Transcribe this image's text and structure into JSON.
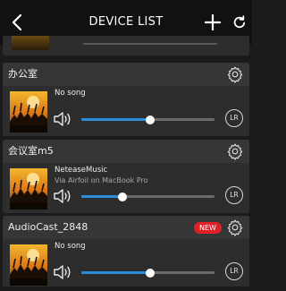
{
  "header": {
    "title": "DEVICE LIST",
    "back_icon": "chevron-left-icon",
    "add_icon": "plus-icon",
    "refresh_icon": "refresh-icon"
  },
  "colors": {
    "accent": "#2c8cd8",
    "badge": "#e01f26",
    "card": "#2d2d2d",
    "background": "#1b1b1b"
  },
  "devices": [
    {
      "name": "办公室",
      "song": "No song",
      "subtitle": "",
      "volume_fraction": 0.52,
      "lr_label": "LR",
      "badge": ""
    },
    {
      "name": "会议室m5",
      "song": "NeteaseMusic",
      "subtitle": "Via Airfoil on MacBook Pro",
      "volume_fraction": 0.31,
      "lr_label": "LR",
      "badge": ""
    },
    {
      "name": "AudioCast_2848",
      "song": "No song",
      "subtitle": "",
      "volume_fraction": 0.52,
      "lr_label": "LR",
      "badge": "NEW"
    }
  ]
}
